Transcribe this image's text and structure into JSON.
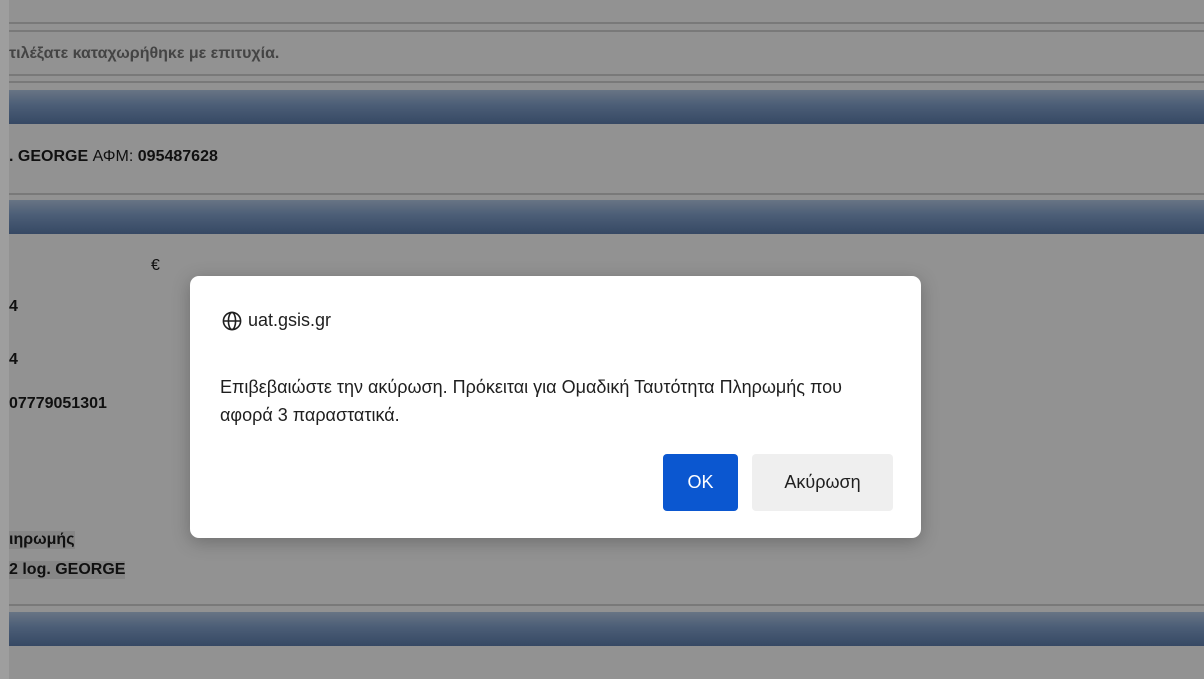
{
  "background": {
    "status_message": "τιλέξατε καταχωρήθηκε με επιτυχία.",
    "taxpayer_name": ". GEORGE",
    "afm_label": "ΑΦΜ:",
    "afm_value": "095487628",
    "currency_symbol": "€",
    "field_1": "4",
    "field_2": "4",
    "reference_code": "07779051301",
    "payment_label": "ιηρωμής",
    "payee_name": "2 log. GEORGE"
  },
  "dialog": {
    "origin": "uat.gsis.gr",
    "origin_icon": "globe-icon",
    "message": "Επιβεβαιώστε την ακύρωση. Πρόκειται για Ομαδική Ταυτότητα Πληρωμής που αφορά 3 παραστατικά.",
    "ok_label": "OK",
    "cancel_label": "Ακύρωση"
  },
  "colors": {
    "ok_button": "#0b57d0",
    "cancel_button": "#efefef",
    "band_dark": "#5876a2",
    "band_light": "#a8bcd6"
  }
}
